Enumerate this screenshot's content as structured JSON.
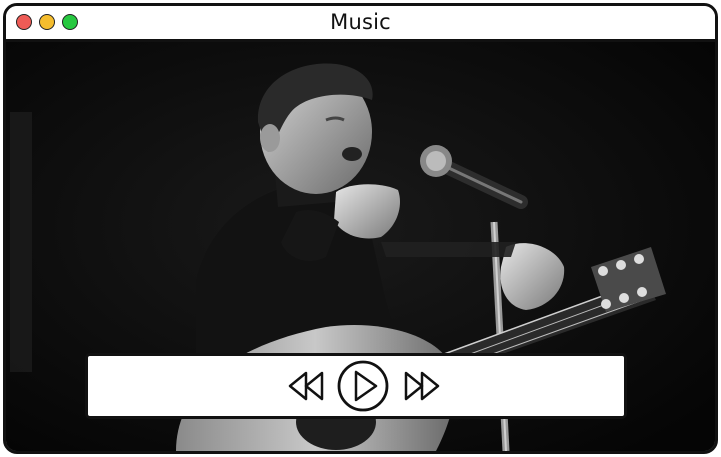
{
  "window": {
    "title": "Music",
    "traffic_lights": {
      "close_color": "#ee5b56",
      "minimize_color": "#f5bd2e",
      "maximize_color": "#27c840"
    }
  },
  "media": {
    "image_icon": "black-and-white-concert-photo"
  },
  "controls": {
    "rewind_icon": "rewind-icon",
    "play_icon": "play-icon",
    "fast_forward_icon": "fast-forward-icon"
  }
}
